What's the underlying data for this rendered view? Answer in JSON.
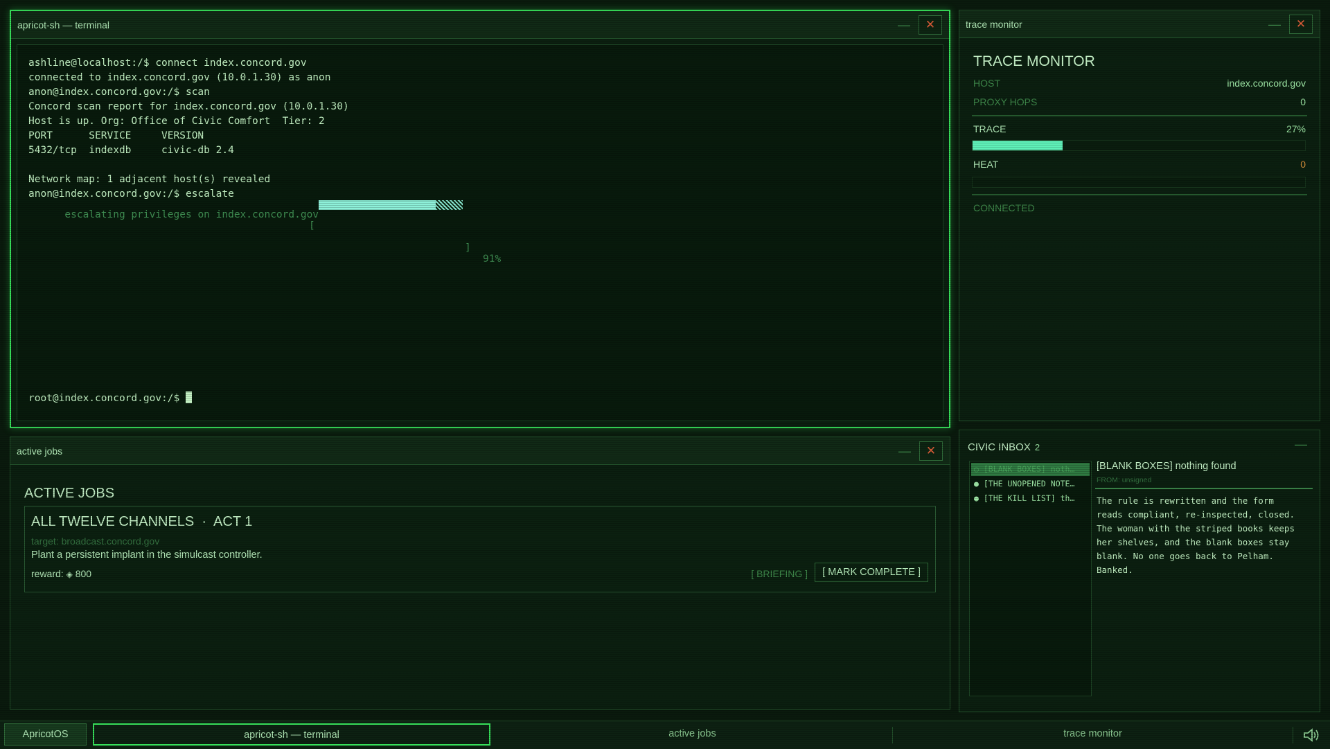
{
  "terminal": {
    "title": "apricot-sh — terminal",
    "lines": [
      "ashline@localhost:/$ connect index.concord.gov",
      "connected to index.concord.gov (10.0.1.30) as anon",
      "anon@index.concord.gov:/$ scan",
      "Concord scan report for index.concord.gov (10.0.1.30)",
      "Host is up. Org: Office of Civic Comfort  Tier: 2",
      "PORT      SERVICE     VERSION",
      "5432/tcp  indexdb     civic-db 2.4",
      "Network map: 1 adjacent host(s) revealed",
      "anon@index.concord.gov:/$ escalate"
    ],
    "progress_label": "escalating privileges on index.concord.gov",
    "progress_open": "[",
    "progress_close": "]",
    "progress_percent_text": "91%",
    "progress_value": 0.91,
    "prompt": "root@index.concord.gov:/$ "
  },
  "trace": {
    "window_title": "trace monitor",
    "heading": "TRACE MONITOR",
    "host_label": "HOST",
    "host_value": "index.concord.gov",
    "hops_label": "PROXY HOPS",
    "hops_value": "0",
    "trace_label": "TRACE",
    "trace_value_text": "27%",
    "trace_value": 0.27,
    "heat_label": "HEAT",
    "heat_value_text": "0",
    "heat_value": 0,
    "status": "CONNECTED"
  },
  "jobs": {
    "window_title": "active jobs",
    "heading": "ACTIVE JOBS",
    "job": {
      "name": "ALL TWELVE CHANNELS  ·  ACT 1",
      "target": "target: broadcast.concord.gov",
      "description": "Plant a persistent implant in the simulcast controller.",
      "reward_label": "reward:",
      "reward_icon": "◈",
      "reward_value": "800",
      "briefing_label": "[ BRIEFING ]",
      "complete_label": "[ MARK COMPLETE ]"
    }
  },
  "inbox": {
    "title": "CIVIC INBOX",
    "count": "2",
    "items": [
      "○ [BLANK BOXES] noth…",
      "● [THE UNOPENED NOTE…",
      "● [THE KILL LIST] th…"
    ],
    "subject": "[BLANK BOXES] nothing found",
    "from": "FROM: unsigned",
    "body": "The rule is rewritten and the form reads compliant, re-inspected, closed. The woman with the striped books keeps her shelves, and the blank boxes stay blank. No one goes back to Pelham. Banked."
  },
  "taskbar": {
    "start_label": "ApricotOS",
    "tasks": [
      "apricot-sh — terminal",
      "active jobs",
      "trace monitor"
    ]
  },
  "controls": {
    "minimize_glyph": "—",
    "close_glyph": "✕"
  },
  "colors": {
    "accent": "#37e05a",
    "progress": "#8ef0d9",
    "trace_bar": "#5ff0b8",
    "close": "#e3603a",
    "background": "#0a1a0d"
  }
}
